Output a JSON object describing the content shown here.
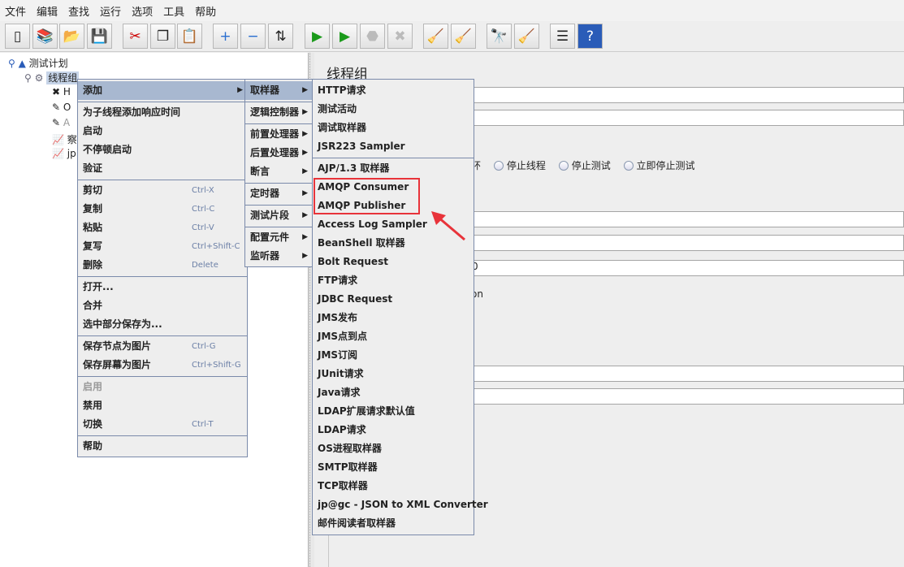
{
  "menubar": [
    "文件",
    "编辑",
    "查找",
    "运行",
    "选项",
    "工具",
    "帮助"
  ],
  "toolbar": [
    {
      "icon": "new-icon",
      "g": "▯"
    },
    {
      "icon": "templates-icon",
      "g": "📚"
    },
    {
      "icon": "open-icon",
      "g": "📂"
    },
    {
      "icon": "save-icon",
      "g": "💾"
    },
    {
      "icon": "cut-icon",
      "g": "✂"
    },
    {
      "icon": "copy-icon",
      "g": "❐"
    },
    {
      "icon": "paste-icon",
      "g": "📋"
    },
    {
      "icon": "expand-icon",
      "g": "+"
    },
    {
      "icon": "collapse-icon",
      "g": "−"
    },
    {
      "icon": "toggle-icon",
      "g": "⇅"
    },
    {
      "icon": "start-icon",
      "g": "▶"
    },
    {
      "icon": "start-no-pause-icon",
      "g": "▶"
    },
    {
      "icon": "stop-icon",
      "g": "⬣"
    },
    {
      "icon": "shutdown-icon",
      "g": "✖"
    },
    {
      "icon": "clear-icon",
      "g": "🧹"
    },
    {
      "icon": "clear-all-icon",
      "g": "🧹"
    },
    {
      "icon": "search-icon",
      "g": "🔭"
    },
    {
      "icon": "reset-search-icon",
      "g": "🧹"
    },
    {
      "icon": "function-helper-icon",
      "g": "☰"
    },
    {
      "icon": "help-icon",
      "g": "?"
    }
  ],
  "tree": {
    "root": "测试计划",
    "selected": "线程组",
    "children": [
      "H",
      "O",
      "A",
      "察",
      "jp"
    ]
  },
  "right": {
    "title": "线程组",
    "radio_partial": "环",
    "radios": [
      "停止线程",
      "停止测试",
      "立即停止测试"
    ],
    "partial_value": "0",
    "partial_text": "on"
  },
  "menu_main": [
    {
      "label": "添加",
      "arrow": true,
      "hl": true
    },
    {
      "sep": true
    },
    {
      "label": "为子线程添加响应时间"
    },
    {
      "label": "启动"
    },
    {
      "label": "不停顿启动"
    },
    {
      "label": "验证"
    },
    {
      "sep": true
    },
    {
      "label": "剪切",
      "sc": "Ctrl-X"
    },
    {
      "label": "复制",
      "sc": "Ctrl-C"
    },
    {
      "label": "粘贴",
      "sc": "Ctrl-V"
    },
    {
      "label": "复写",
      "sc": "Ctrl+Shift-C"
    },
    {
      "label": "删除",
      "sc": "Delete"
    },
    {
      "sep": true
    },
    {
      "label": "打开..."
    },
    {
      "label": "合并"
    },
    {
      "label": "选中部分保存为..."
    },
    {
      "sep": true
    },
    {
      "label": "保存节点为图片",
      "sc": "Ctrl-G"
    },
    {
      "label": "保存屏幕为图片",
      "sc": "Ctrl+Shift-G"
    },
    {
      "sep": true
    },
    {
      "label": "启用",
      "disabled": true
    },
    {
      "label": "禁用"
    },
    {
      "label": "切换",
      "sc": "Ctrl-T"
    },
    {
      "sep": true
    },
    {
      "label": "帮助"
    }
  ],
  "menu_add": [
    {
      "label": "取样器",
      "arrow": true,
      "hl": true
    },
    {
      "sep": true
    },
    {
      "label": "逻辑控制器",
      "arrow": true
    },
    {
      "sep": true
    },
    {
      "label": "前置处理器",
      "arrow": true
    },
    {
      "label": "后置处理器",
      "arrow": true
    },
    {
      "label": "断言",
      "arrow": true
    },
    {
      "sep": true
    },
    {
      "label": "定时器",
      "arrow": true
    },
    {
      "sep": true
    },
    {
      "label": "测试片段",
      "arrow": true
    },
    {
      "sep": true
    },
    {
      "label": "配置元件",
      "arrow": true
    },
    {
      "label": "监听器",
      "arrow": true
    }
  ],
  "menu_sampler": [
    {
      "label": "HTTP请求"
    },
    {
      "label": "测试活动"
    },
    {
      "label": "调试取样器"
    },
    {
      "label": "JSR223 Sampler"
    },
    {
      "sep": true
    },
    {
      "label": "AJP/1.3 取样器"
    },
    {
      "label": "AMQP Consumer"
    },
    {
      "label": "AMQP Publisher"
    },
    {
      "label": "Access Log Sampler"
    },
    {
      "label": "BeanShell 取样器"
    },
    {
      "label": "Bolt Request"
    },
    {
      "label": "FTP请求"
    },
    {
      "label": "JDBC Request"
    },
    {
      "label": "JMS发布"
    },
    {
      "label": "JMS点到点"
    },
    {
      "label": "JMS订阅"
    },
    {
      "label": "JUnit请求"
    },
    {
      "label": "Java请求"
    },
    {
      "label": "LDAP扩展请求默认值"
    },
    {
      "label": "LDAP请求"
    },
    {
      "label": "OS进程取样器"
    },
    {
      "label": "SMTP取样器"
    },
    {
      "label": "TCP取样器"
    },
    {
      "label": "jp@gc - JSON to XML Converter"
    },
    {
      "label": "邮件阅读者取样器"
    }
  ],
  "colors": {
    "highlight": "#a8b8d0",
    "annotation": "#e8333a"
  }
}
